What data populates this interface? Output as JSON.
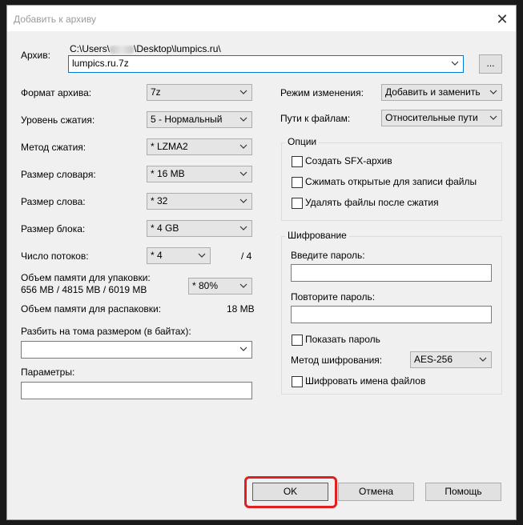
{
  "window": {
    "title": "Добавить к архиву"
  },
  "archive": {
    "label": "Архив:",
    "path_prefix": "C:\\Users\\",
    "path_suffix": "\\Desktop\\lumpics.ru\\",
    "name": "lumpics.ru.7z",
    "browse_label": "..."
  },
  "left": {
    "format": {
      "label": "Формат архива:",
      "value": "7z"
    },
    "level": {
      "label": "Уровень сжатия:",
      "value": "5 - Нормальный"
    },
    "method": {
      "label": "Метод сжатия:",
      "value": "*  LZMA2"
    },
    "dict": {
      "label": "Размер словаря:",
      "value": "*  16 MB"
    },
    "word": {
      "label": "Размер слова:",
      "value": "*  32"
    },
    "block": {
      "label": "Размер блока:",
      "value": "*  4 GB"
    },
    "threads": {
      "label": "Число потоков:",
      "value": "*  4",
      "max": "/ 4"
    },
    "mem_pack": {
      "label": "Объем памяти для упаковки:",
      "detail": "656 MB / 4815 MB / 6019 MB",
      "value": "* 80%"
    },
    "mem_unpack": {
      "label": "Объем памяти для распаковки:",
      "value": "18 MB"
    },
    "split": {
      "label": "Разбить на тома размером (в байтах):",
      "value": ""
    },
    "params": {
      "label": "Параметры:",
      "value": ""
    }
  },
  "right": {
    "update_mode": {
      "label": "Режим изменения:",
      "value": "Добавить и заменить"
    },
    "path_mode": {
      "label": "Пути к файлам:",
      "value": "Относительные пути"
    },
    "options": {
      "title": "Опции",
      "sfx": "Создать SFX-архив",
      "shared": "Сжимать открытые для записи файлы",
      "delete": "Удалять файлы после сжатия"
    },
    "encryption": {
      "title": "Шифрование",
      "password_label": "Введите пароль:",
      "repeat_label": "Повторите пароль:",
      "show_password": "Показать пароль",
      "method_label": "Метод шифрования:",
      "method_value": "AES-256",
      "encrypt_names": "Шифровать имена файлов"
    }
  },
  "buttons": {
    "ok": "OK",
    "cancel": "Отмена",
    "help": "Помощь"
  },
  "colors": {
    "highlight": "#e02020",
    "accent": "#0078d7"
  }
}
